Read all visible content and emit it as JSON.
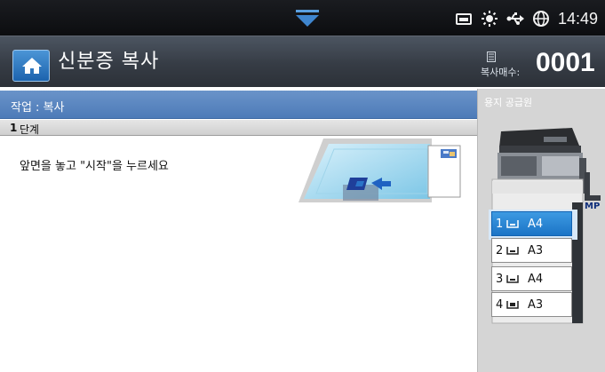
{
  "status_bar": {
    "time": "14:49",
    "icons": [
      "toner-icon",
      "eco-sun-icon",
      "usb-icon",
      "globe-icon"
    ]
  },
  "header": {
    "title": "신분증 복사",
    "counter_label": "복사매수:",
    "counter_value": "0001"
  },
  "task": {
    "label": "작업 : 복사",
    "step_number": "1",
    "step_label": "단계",
    "instruction": "앞면을 놓고 \"시작\"을 누르세요"
  },
  "paper_source": {
    "title": "용지 공급원",
    "mp_label": "MP",
    "trays": [
      {
        "number": "1",
        "size": "A4",
        "selected": true
      },
      {
        "number": "2",
        "size": "A3",
        "selected": false
      },
      {
        "number": "3",
        "size": "A4",
        "selected": false
      },
      {
        "number": "4",
        "size": "A3",
        "selected": false
      }
    ]
  },
  "colors": {
    "accent": "#1b74c6",
    "task_bar": "#5a86c0",
    "title_bar": "#3a4049",
    "panel": "#d5d5d5"
  }
}
